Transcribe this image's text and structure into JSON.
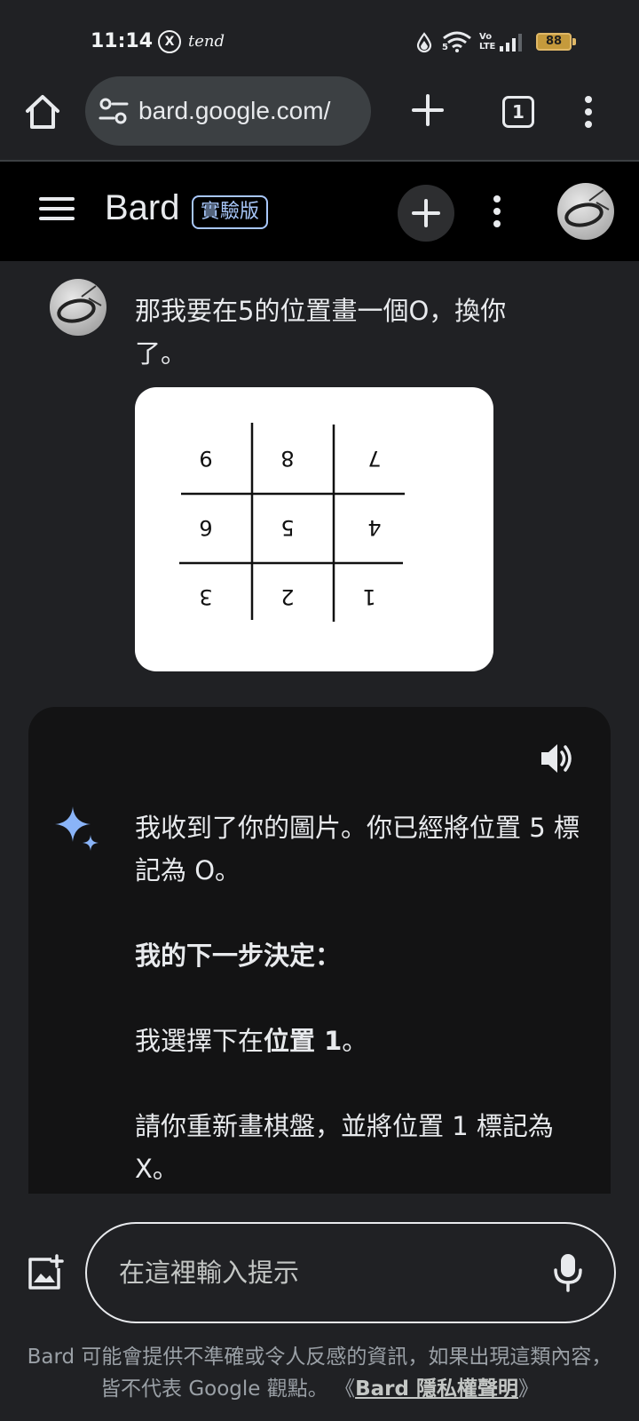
{
  "status_bar": {
    "time": "11:14",
    "x_badge": "X",
    "app_label": "tend",
    "network_label": "5",
    "volte_label": "Vo LTE",
    "battery": "88"
  },
  "browser": {
    "url": "bard.google.com/",
    "tab_count": "1",
    "icons": [
      "home-icon",
      "tune-icon",
      "plus-icon",
      "tab-switcher-icon",
      "more-vert-icon"
    ]
  },
  "bard_header": {
    "title": "Bard",
    "badge": "實驗版"
  },
  "user_message": {
    "text": "那我要在5的位置畫一個O，換你了。",
    "board_digits": [
      "9",
      "8",
      "7",
      "6",
      "5",
      "4",
      "3",
      "2",
      "1"
    ]
  },
  "response": {
    "p1": "我收到了你的圖片。你已經將位置 5 標記為 O。",
    "p2": "我的下一步決定：",
    "p3_prefix": "我選擇下在",
    "p3_bold": "位置 1",
    "p3_suffix": "。",
    "p4": "請你重新畫棋盤，並將位置 1 標記為 X。"
  },
  "input": {
    "placeholder": "在這裡輸入提示"
  },
  "disclaimer": {
    "text": "Bard 可能會提供不準確或令人反感的資訊，如果出現這類內容，皆不代表 Google 觀點。",
    "link_open": "《",
    "link": "Bard 隱私權聲明",
    "link_close": "》"
  },
  "colors": {
    "background": "#202124",
    "header": "#000000",
    "response_card": "#131314",
    "accent": "#a8c7fa",
    "battery": "#c59a3c"
  }
}
